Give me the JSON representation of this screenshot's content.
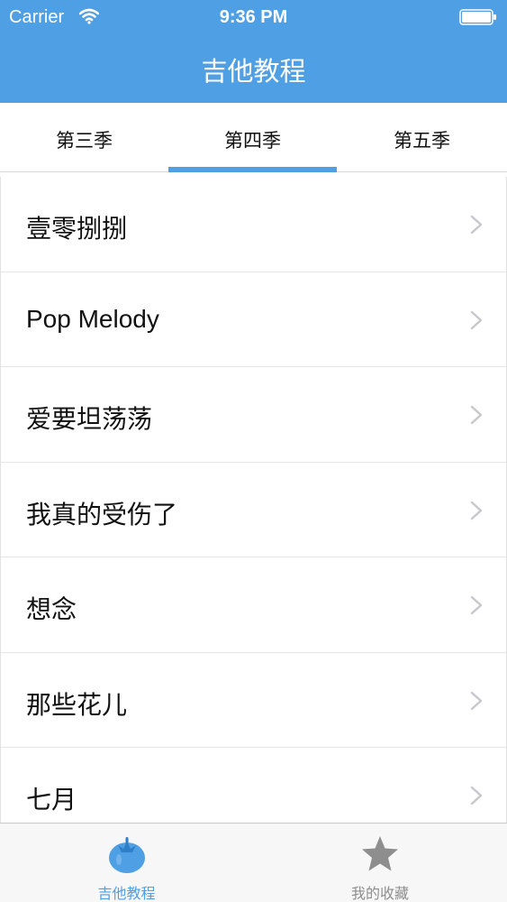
{
  "status_bar": {
    "carrier": "Carrier",
    "time": "9:36 PM",
    "wifi_icon": "wifi-icon",
    "battery_icon": "battery-icon"
  },
  "nav": {
    "title": "吉他教程"
  },
  "tabs": [
    {
      "label": "第三季",
      "selected": false
    },
    {
      "label": "第四季",
      "selected": true
    },
    {
      "label": "第五季",
      "selected": false
    }
  ],
  "list": {
    "items": [
      {
        "label": "壹零捌捌"
      },
      {
        "label": "Pop Melody"
      },
      {
        "label": "爱要坦荡荡"
      },
      {
        "label": "我真的受伤了"
      },
      {
        "label": "想念"
      },
      {
        "label": "那些花儿"
      },
      {
        "label": "七月"
      }
    ],
    "chevron_icon": "chevron-right-icon"
  },
  "tabbar": {
    "items": [
      {
        "label": "吉他教程",
        "icon": "tomato-icon",
        "active": true
      },
      {
        "label": "我的收藏",
        "icon": "star-icon",
        "active": false
      }
    ]
  },
  "colors": {
    "accent": "#4f9fe4",
    "active_tab_text": "#4f9fe4",
    "inactive_tab_text": "#8e8e8e",
    "chevron": "#c7c7cc"
  }
}
